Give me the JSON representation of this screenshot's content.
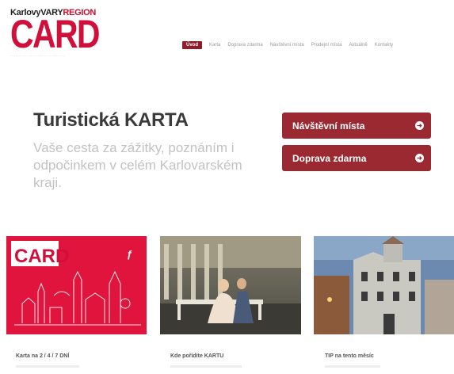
{
  "logo": {
    "top_left": "KarlovyVARY",
    "top_right": "REGION",
    "main": "CARD"
  },
  "nav": {
    "items": [
      "Úvod",
      "Karta",
      "Doprava zdarma",
      "Návštěvní místa",
      "Prodejní místa",
      "Aktuálně",
      "Kontakty"
    ]
  },
  "hero": {
    "title": "Turistická KARTA",
    "subtitle": "Vaše cesta za zážitky, poznáním i odpočinkem v celém Karlovarském kraji."
  },
  "cta": {
    "places": "Návštěvní místa",
    "transport": "Doprava zdarma"
  },
  "cards": [
    {
      "caption": "Karta na 2 / 4 / 7 DNÍ",
      "image_card_text": "CARD"
    },
    {
      "caption": "Kde pořídíte KARTU"
    },
    {
      "caption": "TIP na tento měsíc"
    }
  ],
  "colors": {
    "brand_red": "#d0103a",
    "cta": "#9b2932",
    "nav_active": "#8b1e2a"
  }
}
